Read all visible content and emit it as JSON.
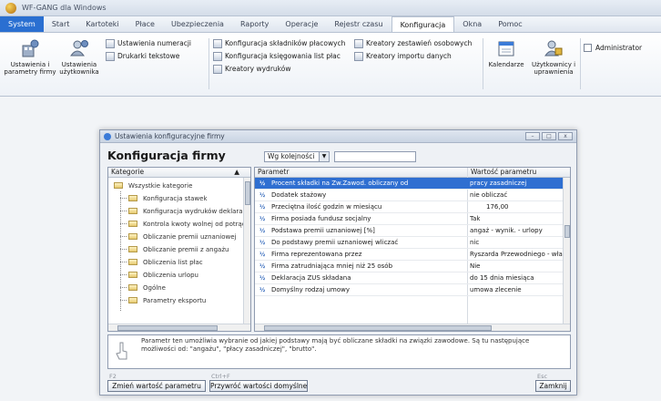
{
  "window": {
    "title": "WF-GANG dla Windows"
  },
  "menu": {
    "items": [
      {
        "label": "System",
        "style": "system"
      },
      {
        "label": "Start",
        "style": ""
      },
      {
        "label": "Kartoteki",
        "style": ""
      },
      {
        "label": "Płace",
        "style": ""
      },
      {
        "label": "Ubezpieczenia",
        "style": ""
      },
      {
        "label": "Raporty",
        "style": ""
      },
      {
        "label": "Operacje",
        "style": ""
      },
      {
        "label": "Rejestr czasu",
        "style": ""
      },
      {
        "label": "Konfiguracja",
        "style": "active"
      },
      {
        "label": "Okna",
        "style": ""
      },
      {
        "label": "Pomoc",
        "style": ""
      }
    ]
  },
  "ribbon": {
    "btn_company_settings": "Ustawienia i parametry firmy",
    "btn_user_settings": "Ustawienia użytkownika",
    "numbering_settings": "Ustawienia numeracji",
    "text_printers": "Drukarki tekstowe",
    "payroll_components_config": "Konfiguracja składników płacowych",
    "payroll_posting_config": "Konfiguracja księgowania list płac",
    "printout_wizards": "Kreatory wydruków",
    "personal_sets_wizards": "Kreatory zestawień osobowych",
    "data_import_wizards": "Kreatory importu danych",
    "btn_calendars": "Kalendarze",
    "btn_users_permissions": "Użytkownicy i uprawnienia",
    "admin_checkbox": "Administrator"
  },
  "dialog": {
    "title": "Ustawienia konfiguracyjne firmy",
    "heading": "Konfiguracja firmy",
    "sort_select": "Wg kolejności",
    "search_value": "",
    "categories_header": "Kategorie",
    "categories": [
      "Wszystkie kategorie",
      "Konfiguracja stawek",
      "Konfiguracja wydruków deklaracji",
      "Kontrola kwoty wolnej od potrąceń",
      "Obliczanie premii uznaniowej",
      "Obliczanie premii z angażu",
      "Obliczenia list płac",
      "Obliczenia urlopu",
      "Ogólne",
      "Parametry eksportu"
    ],
    "params_header": "Parametr",
    "values_header": "Wartość parametru",
    "params": [
      {
        "name": "Procent składki na Zw.Zawod. obliczany od",
        "value": "pracy zasadniczej",
        "selected": true
      },
      {
        "name": "Dodatek stażowy",
        "value": "nie obliczać",
        "selected": false
      },
      {
        "name": "Przeciętna ilość godzin w miesiącu",
        "value": "176,00",
        "selected": false
      },
      {
        "name": "Firma posiada fundusz socjalny",
        "value": "Tak",
        "selected": false
      },
      {
        "name": "Podstawa premii uznaniowej [%]",
        "value": "angaż - wynik. - urlopy",
        "selected": false
      },
      {
        "name": "Do podstawy premii uznaniowej wliczać",
        "value": "nic",
        "selected": false
      },
      {
        "name": "Firma reprezentowana przez",
        "value": "Ryszarda Przewodniego - właściciela",
        "selected": false
      },
      {
        "name": "Firma zatrudniająca mniej niż 25 osób",
        "value": "Nie",
        "selected": false
      },
      {
        "name": "Deklaracja ZUS składana",
        "value": "do 15 dnia miesiąca",
        "selected": false
      },
      {
        "name": "Domyślny rodzaj umowy",
        "value": "umowa zlecenie",
        "selected": false
      }
    ],
    "description": "Parametr ten umożliwia wybranie od jakiej podstawy mają być obliczane składki na związki zawodowe. Są tu następujące możliwości od: \"angażu\", \"płacy zasadniczej\", \"brutto\".",
    "key_f2": "F2",
    "key_ctrl_f": "Ctrl+F",
    "key_esc": "Esc",
    "btn_change_value": "Zmień wartość parametru",
    "btn_restore_defaults": "Przywróć wartości domyślne",
    "btn_close": "Zamknij"
  }
}
